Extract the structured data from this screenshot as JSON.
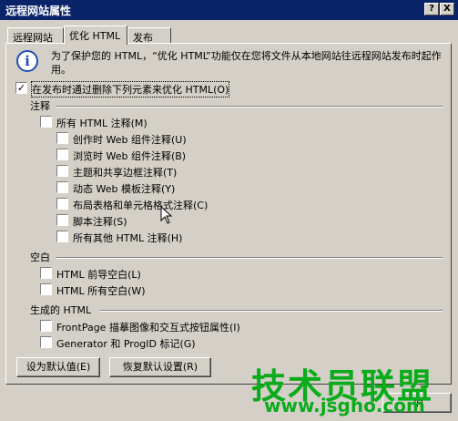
{
  "window": {
    "title": "远程网站属性",
    "help_btn": "?",
    "close_btn": "X"
  },
  "tabs": [
    {
      "label": "远程网站"
    },
    {
      "label": "优化 HTML"
    },
    {
      "label": "发布"
    }
  ],
  "info": {
    "icon": "info-icon",
    "text": "为了保护您的 HTML，“优化 HTML”功能仅在您将文件从本地网站往远程网站发布时起作用。"
  },
  "main_option": {
    "label": "在发布时通过删除下列元素来优化 HTML(O)",
    "checked": true
  },
  "comments": {
    "heading": "注释",
    "all": {
      "label": "所有 HTML 注释(M)",
      "checked": false
    },
    "items": [
      {
        "label": "创作时 Web 组件注释(U)",
        "checked": false
      },
      {
        "label": "浏览时 Web 组件注释(B)",
        "checked": false
      },
      {
        "label": "主题和共享边框注释(T)",
        "checked": false
      },
      {
        "label": "动态 Web 模板注释(Y)",
        "checked": false
      },
      {
        "label": "布局表格和单元格格式注释(C)",
        "checked": false
      },
      {
        "label": "脚本注释(S)",
        "checked": false
      },
      {
        "label": "所有其他 HTML 注释(H)",
        "checked": false
      }
    ]
  },
  "whitespace": {
    "heading": "空白",
    "items": [
      {
        "label": "HTML 前导空白(L)",
        "checked": false
      },
      {
        "label": "HTML 所有空白(W)",
        "checked": false
      }
    ]
  },
  "generated": {
    "heading": "生成的 HTML",
    "items": [
      {
        "label": "FrontPage 描摹图像和交互式按钮属性(I)",
        "checked": false
      },
      {
        "label": "Generator 和 ProgID 标记(G)",
        "checked": false
      }
    ]
  },
  "buttons": {
    "set_default": "设为默认值(E)",
    "restore_default": "恢复默认设置(R)",
    "cancel_partial": "消"
  },
  "watermark": {
    "line1": "技术员联盟",
    "line2": "www.jsgho.com",
    "color": "#0bab1b"
  }
}
